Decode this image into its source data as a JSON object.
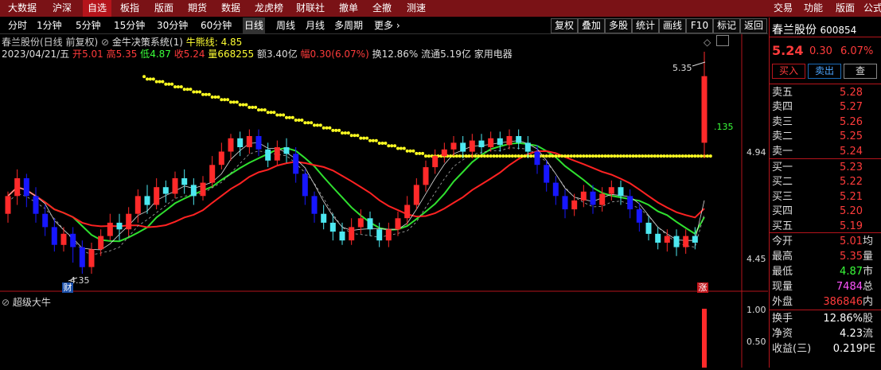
{
  "menu": {
    "items": [
      "大数据",
      "沪深",
      "自选",
      "板指",
      "版面",
      "期货",
      "数据",
      "龙虎榜",
      "财联社",
      "撤单",
      "全撤",
      "测速"
    ],
    "active_index": 2,
    "right_items": [
      "交易",
      "功能",
      "版面",
      "公式"
    ]
  },
  "toolbar": {
    "periods": [
      "分时",
      "1分钟",
      "5分钟",
      "15分钟",
      "30分钟",
      "60分钟",
      "日线",
      "周线",
      "月线",
      "多周期",
      "更多 ›"
    ],
    "active_period": 6,
    "buttons": [
      "复权",
      "叠加",
      "多股",
      "统计",
      "画线",
      "F10",
      "标记",
      "返回"
    ]
  },
  "chart": {
    "title_line": "春兰股份(日线 前复权)",
    "indicator_name": "金牛决策系统(1)",
    "indicator_value": "牛熊线: 4.85",
    "date": "2023/04/21/五",
    "open_label": "开",
    "open": "5.01",
    "high_label": "高",
    "high": "5.35",
    "low_label": "低",
    "low": "4.87",
    "close_label": "收",
    "close": "5.24",
    "volume_label": "量",
    "volume": "668255",
    "amount_label": "额",
    "amount": "3.40亿",
    "change_label": "幅",
    "change": "0.30(6.07%)",
    "turnover": "换12.86%",
    "float_value": "流通5.19亿",
    "sector": "家用电器",
    "price_axis": [
      "4.94",
      "4.45"
    ],
    "side_label": ".135",
    "high_marker": "5.35",
    "low_marker": "4.35",
    "badge_cai": "财",
    "badge_zhang": "涨",
    "sub_title": "超级大牛",
    "sub_axis": [
      "1.00",
      "0.50"
    ],
    "colors": {
      "up": "#ff2a2a",
      "down": "#4de8f0",
      "down_big": "#1717ff",
      "ma_green": "#2fe02f",
      "ma_red": "#ff2222",
      "dots": "#ffff22"
    }
  },
  "chart_data": {
    "type": "candlestick",
    "candles": [
      [
        4.62,
        4.7,
        4.58,
        4.72
      ],
      [
        4.7,
        4.78,
        4.66,
        4.82
      ],
      [
        4.78,
        4.7,
        4.65,
        4.8
      ],
      [
        4.7,
        4.62,
        4.58,
        4.74
      ],
      [
        4.62,
        4.56,
        4.52,
        4.66
      ],
      [
        4.56,
        4.48,
        4.45,
        4.6
      ],
      [
        4.48,
        4.53,
        4.45,
        4.56
      ],
      [
        4.53,
        4.47,
        4.4,
        4.56
      ],
      [
        4.47,
        4.38,
        4.35,
        4.5
      ],
      [
        4.38,
        4.46,
        4.35,
        4.49
      ],
      [
        4.46,
        4.52,
        4.43,
        4.55
      ],
      [
        4.52,
        4.58,
        4.5,
        4.62
      ],
      [
        4.58,
        4.55,
        4.5,
        4.62
      ],
      [
        4.55,
        4.62,
        4.52,
        4.65
      ],
      [
        4.62,
        4.7,
        4.58,
        4.73
      ],
      [
        4.7,
        4.66,
        4.62,
        4.75
      ],
      [
        4.66,
        4.74,
        4.64,
        4.78
      ],
      [
        4.74,
        4.71,
        4.67,
        4.77
      ],
      [
        4.71,
        4.78,
        4.69,
        4.81
      ],
      [
        4.78,
        4.75,
        4.71,
        4.82
      ],
      [
        4.75,
        4.7,
        4.66,
        4.78
      ],
      [
        4.7,
        4.76,
        4.68,
        4.79
      ],
      [
        4.76,
        4.84,
        4.74,
        4.88
      ],
      [
        4.84,
        4.9,
        4.82,
        4.94
      ],
      [
        4.9,
        4.96,
        4.86,
        4.98
      ],
      [
        4.96,
        4.92,
        4.88,
        4.99
      ],
      [
        4.92,
        4.97,
        4.89,
        5.0
      ],
      [
        4.97,
        4.91,
        4.88,
        5.0
      ],
      [
        4.91,
        4.86,
        4.83,
        4.94
      ],
      [
        4.86,
        4.92,
        4.84,
        4.95
      ],
      [
        4.92,
        4.89,
        4.85,
        4.96
      ],
      [
        4.89,
        4.8,
        4.76,
        4.92
      ],
      [
        4.8,
        4.7,
        4.66,
        4.82
      ],
      [
        4.7,
        4.62,
        4.58,
        4.72
      ],
      [
        4.62,
        4.58,
        4.55,
        4.66
      ],
      [
        4.58,
        4.54,
        4.5,
        4.62
      ],
      [
        4.54,
        4.5,
        4.48,
        4.58
      ],
      [
        4.5,
        4.56,
        4.48,
        4.6
      ],
      [
        4.56,
        4.6,
        4.53,
        4.64
      ],
      [
        4.6,
        4.55,
        4.52,
        4.63
      ],
      [
        4.55,
        4.5,
        4.47,
        4.58
      ],
      [
        4.5,
        4.55,
        4.47,
        4.58
      ],
      [
        4.55,
        4.6,
        4.52,
        4.63
      ],
      [
        4.6,
        4.66,
        4.57,
        4.7
      ],
      [
        4.66,
        4.75,
        4.64,
        4.78
      ],
      [
        4.75,
        4.83,
        4.72,
        4.86
      ],
      [
        4.83,
        4.88,
        4.8,
        4.91
      ],
      [
        4.88,
        4.91,
        4.85,
        4.94
      ],
      [
        4.91,
        4.94,
        4.88,
        4.97
      ],
      [
        4.94,
        4.9,
        4.87,
        4.97
      ],
      [
        4.9,
        4.95,
        4.87,
        4.98
      ],
      [
        4.95,
        4.92,
        4.89,
        4.98
      ],
      [
        4.92,
        4.96,
        4.9,
        4.99
      ],
      [
        4.96,
        4.93,
        4.9,
        4.99
      ],
      [
        4.93,
        4.97,
        4.91,
        5.0
      ],
      [
        4.97,
        4.94,
        4.91,
        5.0
      ],
      [
        4.94,
        4.9,
        4.87,
        4.97
      ],
      [
        4.9,
        4.84,
        4.8,
        4.93
      ],
      [
        4.84,
        4.76,
        4.72,
        4.86
      ],
      [
        4.76,
        4.7,
        4.66,
        4.79
      ],
      [
        4.7,
        4.64,
        4.6,
        4.73
      ],
      [
        4.64,
        4.68,
        4.61,
        4.71
      ],
      [
        4.68,
        4.72,
        4.65,
        4.75
      ],
      [
        4.72,
        4.66,
        4.62,
        4.75
      ],
      [
        4.66,
        4.71,
        4.63,
        4.74
      ],
      [
        4.71,
        4.74,
        4.68,
        4.77
      ],
      [
        4.74,
        4.7,
        4.66,
        4.77
      ],
      [
        4.7,
        4.64,
        4.6,
        4.73
      ],
      [
        4.64,
        4.58,
        4.54,
        4.67
      ],
      [
        4.58,
        4.53,
        4.5,
        4.61
      ],
      [
        4.53,
        4.49,
        4.46,
        4.56
      ],
      [
        4.49,
        4.52,
        4.45,
        4.55
      ],
      [
        4.52,
        4.47,
        4.43,
        4.55
      ],
      [
        4.47,
        4.52,
        4.44,
        4.55
      ],
      [
        4.52,
        4.49,
        4.46,
        4.56
      ],
      [
        4.94,
        5.24,
        4.87,
        5.35
      ]
    ],
    "ylim": [
      4.3,
      5.4
    ]
  },
  "quote": {
    "name": "春兰股份",
    "code": "600854",
    "price": "5.24",
    "change": "0.30",
    "pct": "6.07%",
    "buy_btn": "买入",
    "sell_btn": "卖出",
    "extra_btn": "查",
    "asks": [
      {
        "label": "卖五",
        "price": "5.28"
      },
      {
        "label": "卖四",
        "price": "5.27"
      },
      {
        "label": "卖三",
        "price": "5.26"
      },
      {
        "label": "卖二",
        "price": "5.25"
      },
      {
        "label": "卖一",
        "price": "5.24"
      }
    ],
    "bids": [
      {
        "label": "买一",
        "price": "5.23"
      },
      {
        "label": "买二",
        "price": "5.22"
      },
      {
        "label": "买三",
        "price": "5.21"
      },
      {
        "label": "买四",
        "price": "5.20"
      },
      {
        "label": "买五",
        "price": "5.19"
      }
    ],
    "stats": [
      {
        "label": "今开",
        "value": "5.01",
        "color": "red",
        "extra": "均"
      },
      {
        "label": "最高",
        "value": "5.35",
        "color": "red",
        "extra": "量"
      },
      {
        "label": "最低",
        "value": "4.87",
        "color": "green",
        "extra": "市"
      },
      {
        "label": "现量",
        "value": "7484",
        "color": "mag",
        "extra": "总"
      },
      {
        "label": "外盘",
        "value": "386846",
        "color": "red",
        "extra": "内"
      }
    ],
    "stats2": [
      {
        "label": "换手",
        "value": "12.86%",
        "color": "white",
        "extra": "股"
      },
      {
        "label": "净资",
        "value": "4.23",
        "color": "white",
        "extra": "流"
      },
      {
        "label": "收益(三)",
        "value": "0.219",
        "color": "white",
        "extra": "PE"
      }
    ]
  }
}
